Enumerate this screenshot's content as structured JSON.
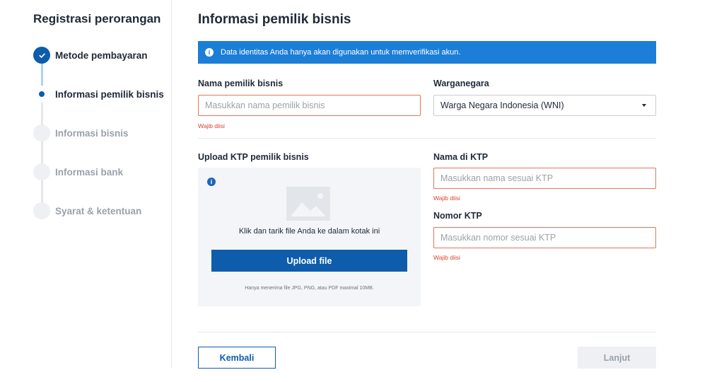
{
  "sidebar": {
    "title": "Registrasi perorangan",
    "steps": [
      {
        "label": "Metode pembayaran",
        "state": "done",
        "icon": "check-icon"
      },
      {
        "label": "Informasi pemilik bisnis",
        "state": "current"
      },
      {
        "label": "Informasi bisnis",
        "state": "pending"
      },
      {
        "label": "Informasi bank",
        "state": "pending"
      },
      {
        "label": "Syarat & ketentuan",
        "state": "pending"
      }
    ]
  },
  "main": {
    "title": "Informasi pemilik bisnis",
    "banner": {
      "text": "Data identitas Anda hanya akan digunakan untuk memverifikasi akun.",
      "icon": "info-icon"
    },
    "owner_name": {
      "label": "Nama pemilik bisnis",
      "placeholder": "Masukkan nama pemilik bisnis",
      "value": "",
      "error": "Wajib diisi"
    },
    "citizenship": {
      "label": "Warganegara",
      "selected": "Warga Negara Indonesia (WNI)",
      "icon": "caret-down-icon"
    },
    "upload": {
      "label": "Upload KTP pemilik bisnis",
      "instruction": "Klik dan tarik file Anda ke dalam kotak ini",
      "button": "Upload file",
      "note": "Hanya menerima file JPG, PNG, atau PDF maximal 10MB.",
      "icons": [
        "info-icon",
        "image-placeholder-icon"
      ]
    },
    "ktp_name": {
      "label": "Nama di KTP",
      "placeholder": "Masukkan nama sesuai KTP",
      "value": "",
      "error": "Wajib diisi"
    },
    "ktp_number": {
      "label": "Nomor KTP",
      "placeholder": "Masukkan nomor sesuai KTP",
      "value": "",
      "error": "Wajib diisi"
    }
  },
  "footer": {
    "back_label": "Kembali",
    "next_label": "Lanjut",
    "next_disabled": true
  },
  "colors": {
    "primary": "#0e5cac",
    "banner": "#1c7ed6",
    "error": "#d9412e",
    "error_border": "#e0765b",
    "disabled_bg": "#eef0f3"
  }
}
